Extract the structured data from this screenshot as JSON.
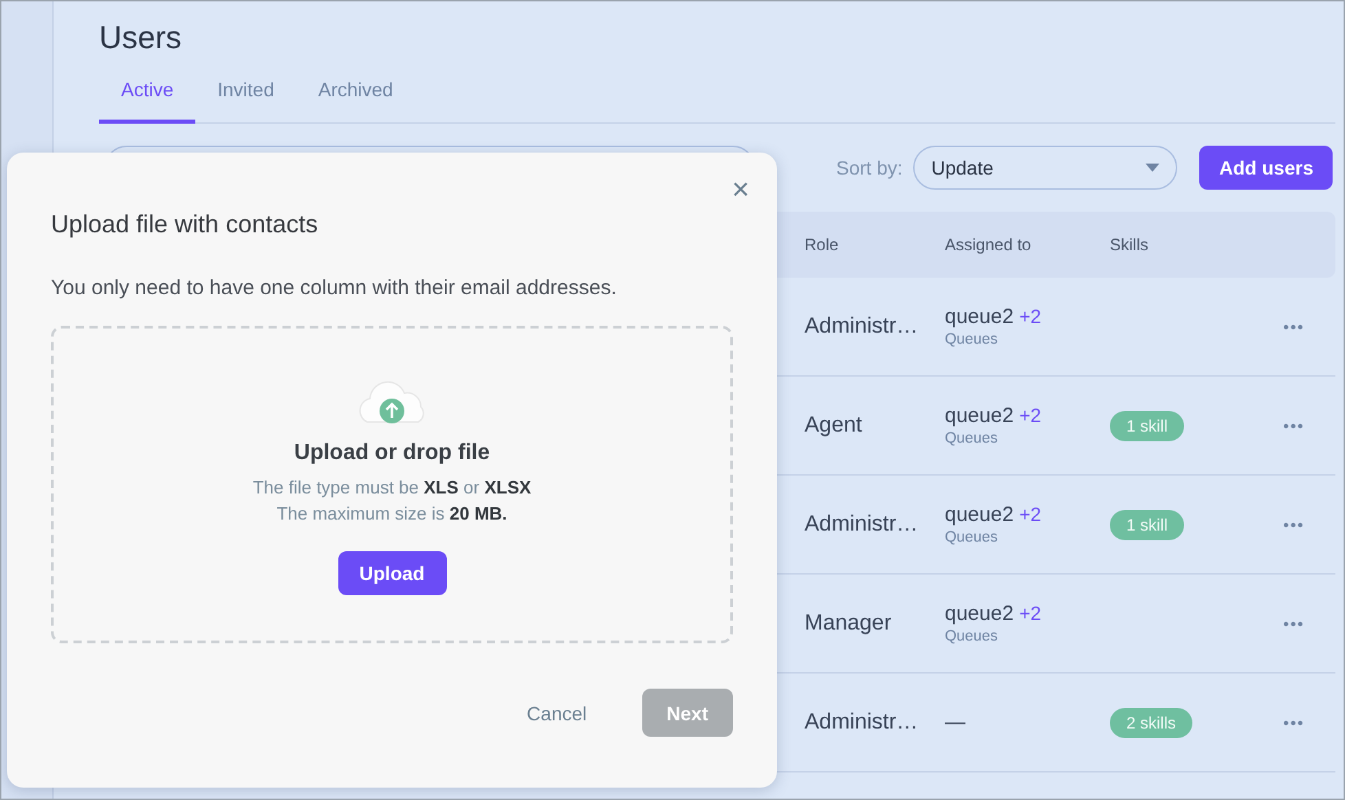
{
  "page": {
    "title": "Users"
  },
  "tabs": [
    {
      "label": "Active",
      "selected": true
    },
    {
      "label": "Invited",
      "selected": false
    },
    {
      "label": "Archived",
      "selected": false
    }
  ],
  "toolbar": {
    "sort_label": "Sort by:",
    "sort_value": "Update",
    "add_button": "Add users"
  },
  "table": {
    "columns": [
      "Role",
      "Assigned to",
      "Skills"
    ],
    "rows": [
      {
        "role": "Administr…",
        "assigned": {
          "kind": "queue",
          "name": "queue2",
          "extra": "+2",
          "type": "Queues"
        },
        "menu": "•••"
      },
      {
        "role": "Agent",
        "assigned": {
          "kind": "queue",
          "name": "queue2",
          "extra": "+2",
          "type": "Queues"
        },
        "skills": "1 skill",
        "menu": "•••"
      },
      {
        "role": "Administr…",
        "assigned": {
          "kind": "queue",
          "name": "queue2",
          "extra": "+2",
          "type": "Queues"
        },
        "skills": "1 skill",
        "menu": "•••"
      },
      {
        "role": "Manager",
        "assigned": {
          "kind": "queue",
          "name": "queue2",
          "extra": "+2",
          "type": "Queues"
        },
        "menu": "•••"
      },
      {
        "role": "Administr…",
        "assigned": {
          "kind": "none",
          "name": "—"
        },
        "skills": "2 skills",
        "menu": "•••"
      }
    ]
  },
  "dialog": {
    "close": "×",
    "title": "Upload file with contacts",
    "description": "You only need to have one column with their email addresses.",
    "dropzone": {
      "heading": "Upload or drop file",
      "lines": [
        "The file type must be **XLS** or **XLSX**",
        "The maximum size is **20 MB.**"
      ],
      "button": "Upload"
    },
    "buttons": [
      {
        "label": "Cancel",
        "kind": "text",
        "disabled": false
      },
      {
        "label": "Next",
        "kind": "primary",
        "disabled": true
      }
    ]
  }
}
